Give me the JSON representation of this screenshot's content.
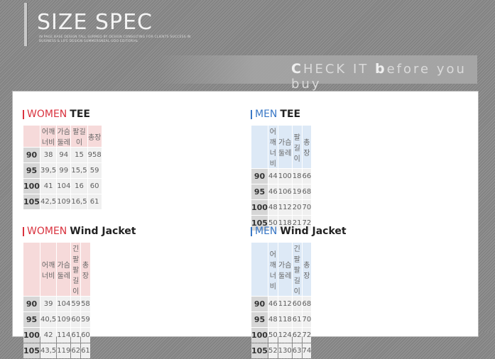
{
  "header": {
    "title": "SIZE SPEC",
    "subtitle": "IN PAGE BASE DESIGN TALL SURMED BY DESIGN CONSULTING FOR CLIENTS SUCCESS IN BUSINESS & LIFE DESIGN SUMMERSNEAL UDO EDITORIAL",
    "check_prefix": "C",
    "check_middle": "HECK IT ",
    "check_b": "b",
    "check_rest": "efore you buy"
  },
  "columns_basic": [
    "어깨너비",
    "가슴둘레",
    "팔길이",
    "총장"
  ],
  "columns_jacket": [
    "어깨너비",
    "가슴둘레",
    "긴팔팔길이",
    "총장"
  ],
  "tables": [
    {
      "gender": "WOMEN",
      "type": "TEE",
      "rows": [
        {
          "size": "90",
          "values": [
            "38",
            "94",
            "15",
            "958"
          ]
        },
        {
          "size": "95",
          "values": [
            "39,5",
            "99",
            "15,5",
            "59"
          ]
        },
        {
          "size": "100",
          "values": [
            "41",
            "104",
            "16",
            "60"
          ]
        },
        {
          "size": "105",
          "values": [
            "42,5",
            "109",
            "16,5",
            "61"
          ]
        }
      ]
    },
    {
      "gender": "MEN",
      "type": "TEE",
      "rows": [
        {
          "size": "90",
          "values": [
            "44",
            "100",
            "18",
            "66"
          ]
        },
        {
          "size": "95",
          "values": [
            "46",
            "106",
            "19",
            "68"
          ]
        },
        {
          "size": "100",
          "values": [
            "48",
            "112",
            "20",
            "70"
          ]
        },
        {
          "size": "105",
          "values": [
            "50",
            "118",
            "21",
            "72"
          ]
        }
      ]
    },
    {
      "gender": "WOMEN",
      "type": "Wind Jacket",
      "rows": [
        {
          "size": "90",
          "values": [
            "39",
            "104",
            "59",
            "58"
          ]
        },
        {
          "size": "95",
          "values": [
            "40,5",
            "109",
            "60",
            "59"
          ]
        },
        {
          "size": "100",
          "values": [
            "42",
            "114",
            "61",
            "60"
          ]
        },
        {
          "size": "105",
          "values": [
            "43,5",
            "119",
            "62",
            "61"
          ]
        }
      ]
    },
    {
      "gender": "MEN",
      "type": "Wind Jacket",
      "rows": [
        {
          "size": "90",
          "values": [
            "46",
            "112",
            "60",
            "68"
          ]
        },
        {
          "size": "95",
          "values": [
            "48",
            "118",
            "61",
            "70"
          ]
        },
        {
          "size": "100",
          "values": [
            "50",
            "124",
            "62",
            "72"
          ]
        },
        {
          "size": "105",
          "values": [
            "52",
            "130",
            "63",
            "74"
          ]
        }
      ]
    }
  ],
  "colors": {
    "women_accent": "#d9323e",
    "men_accent": "#3a78c6",
    "women_header_bg": "#f6dada",
    "men_header_bg": "#dde9f6"
  }
}
